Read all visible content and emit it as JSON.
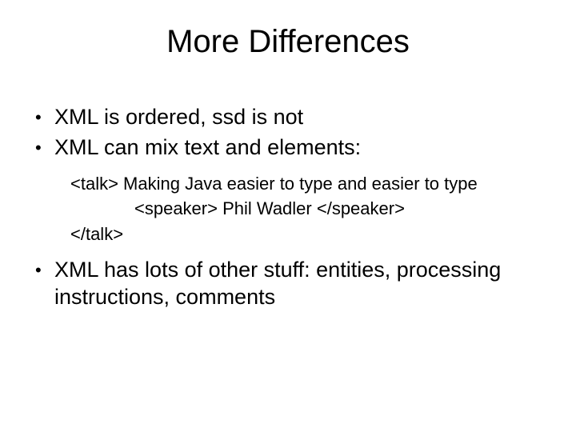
{
  "title": "More Differences",
  "bullets": {
    "b1": "XML is ordered, ssd is not",
    "b2": "XML can mix text and elements:",
    "b3": "XML has lots of other stuff: entities, processing instructions, comments"
  },
  "code": {
    "line1": "<talk> Making Java easier to type and easier to type",
    "line2": "<speaker> Phil Wadler </speaker>",
    "line3": "</talk>"
  }
}
